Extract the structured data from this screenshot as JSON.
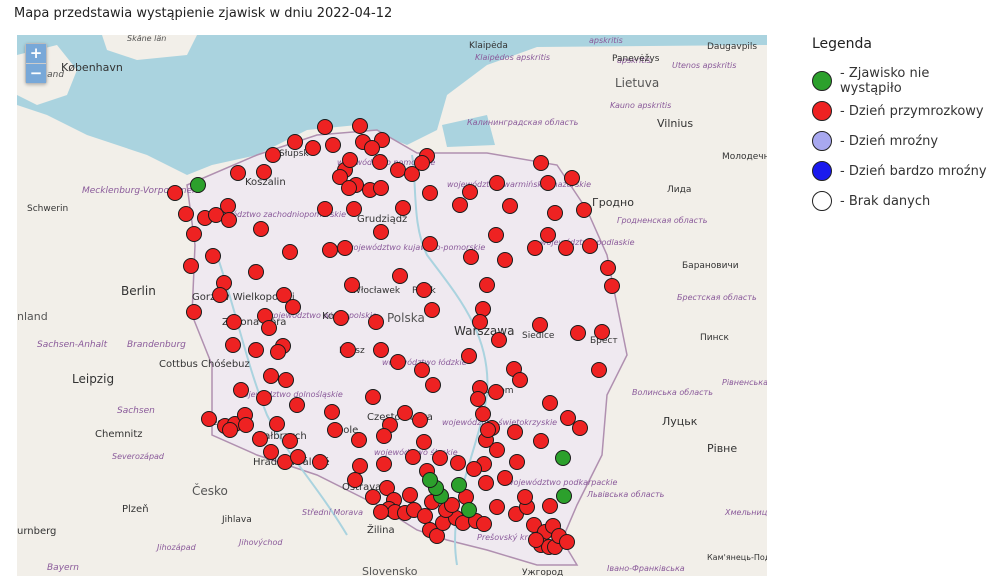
{
  "title": "Mapa przedstawia wystąpienie zjawisk w dniu 2022-04-12",
  "zoom": {
    "in_label": "+",
    "out_label": "−"
  },
  "legend": {
    "heading": "Legenda",
    "items": [
      {
        "label": "- Zjawisko nie wystąpiło",
        "color": "#2ca02c"
      },
      {
        "label": "- Dzień przymrozkowy",
        "color": "#ee2222"
      },
      {
        "label": "- Dzień mroźny",
        "color": "#a8a8f0"
      },
      {
        "label": "- Dzień bardzo mroźny",
        "color": "#1a1aee"
      },
      {
        "label": "- Brak danych",
        "color": "#ffffff"
      }
    ]
  },
  "map_labels": {
    "kobenhavn": "København",
    "sjaelland": "Sjælland",
    "skane": "Skåne län",
    "klaipeda": "Klaipėda",
    "klaipedos": "Klaipėdos apskritis",
    "apskritis1": "apskritis",
    "apskritis2": "apskritis",
    "panevezys": "Panevėžys",
    "utenos": "Utenos apskritis",
    "daugavpils": "Daugavpils",
    "lietuva": "Lietuva",
    "kauno": "Kauno apskritis",
    "vilnius": "Vilnius",
    "kaliningrad": "Калининградская область",
    "molodechno": "Молодечно",
    "mecklenburg": "Mecklenburg-Vorpommern",
    "schwerin": "Schwerin",
    "koszalin": "Koszalin",
    "slupsk": "Słupsk",
    "pomorskie": "województwo pomorskie",
    "warminsko": "województwo warmińsko-mazurskie",
    "lida": "Лида",
    "grodno": "Гродно",
    "grodnenskaya": "Гродненская область",
    "grudziadz": "Grudziądz",
    "zachodnio": "województwo zachodniopomorskie",
    "kujawsko": "województwo kujawsko-pomorskie",
    "podlaskie": "województwo podlaskie",
    "baranovichi": "Барановичи",
    "berlin": "Berlin",
    "gorzow": "Gorzów Wielkopolski",
    "wloclawek": "Włocławek",
    "plock": "Płock",
    "brestobl": "Брестская область",
    "land": "nland",
    "wielkopolskie": "województwo wielkopolskie",
    "konin": "Konin",
    "polska": "Polska",
    "warszawa": "Warszawa",
    "siedlce": "Siedlce",
    "brest": "Брест",
    "pinsk": "Пинск",
    "zielona": "Zielona Góra",
    "sachsen_anhalt": "Sachsen-Anhalt",
    "brandenburg": "Brandenburg",
    "kalisz": "Kalisz",
    "lodzkie": "województwo łódzkie",
    "leipzig": "Leipzig",
    "cottbus": "Cottbus Chóśebuz",
    "radom": "Radom",
    "volynska": "Волинська область",
    "rivnenska": "Рівненська область",
    "sachsen": "Sachsen",
    "dolnoslaskie": "województwo dolnośląskie",
    "legnica": "Legnica",
    "czestochowa": "Częstochowa",
    "chemnitz": "Chemnitz",
    "walbrzych": "Wałbrzych",
    "opole": "Opole",
    "swietokrzyskie": "województwo świętokrzyskie",
    "lutsk": "Луцьк",
    "rivne": "Рівне",
    "severozapad": "Severozápad",
    "hradec": "Hradec Králové",
    "slaskie": "województwo śląskie",
    "cesko": "Česko",
    "ostrava": "Ostrava",
    "podkarpackie": "województwo podkarpackie",
    "lvivska": "Львівська область",
    "plzen": "Plzeň",
    "jihlava": "Jihlava",
    "stredni": "Střední Morava",
    "khmelnytska": "Хмельницька область",
    "urnberg": "urnberg",
    "jihozapad": "Jihozápad",
    "jihovychod": "Jihovýchod",
    "zilina": "Žilina",
    "presovsky": "Prešovský kraj",
    "kamianets": "Кам'янець-Подільський",
    "bayern": "Bayern",
    "slovensko": "Slovensko",
    "uzhgorod": "Ужгород",
    "ivano": "Івано-Франківська"
  },
  "stations": {
    "green": [
      [
        198,
        185
      ],
      [
        563,
        458
      ],
      [
        564,
        496
      ],
      [
        459,
        485
      ],
      [
        469,
        510
      ],
      [
        441,
        496
      ],
      [
        436,
        488
      ],
      [
        430,
        480
      ]
    ],
    "red": [
      [
        175,
        193
      ],
      [
        186,
        214
      ],
      [
        194,
        234
      ],
      [
        191,
        266
      ],
      [
        205,
        218
      ],
      [
        228,
        206
      ],
      [
        216,
        215
      ],
      [
        229,
        220
      ],
      [
        261,
        229
      ],
      [
        238,
        173
      ],
      [
        264,
        172
      ],
      [
        273,
        155
      ],
      [
        295,
        142
      ],
      [
        325,
        127
      ],
      [
        313,
        148
      ],
      [
        333,
        145
      ],
      [
        360,
        126
      ],
      [
        363,
        142
      ],
      [
        345,
        170
      ],
      [
        382,
        140
      ],
      [
        380,
        162
      ],
      [
        372,
        148
      ],
      [
        350,
        160
      ],
      [
        340,
        177
      ],
      [
        356,
        185
      ],
      [
        370,
        190
      ],
      [
        381,
        188
      ],
      [
        398,
        170
      ],
      [
        412,
        174
      ],
      [
        427,
        156
      ],
      [
        422,
        163
      ],
      [
        430,
        193
      ],
      [
        403,
        208
      ],
      [
        354,
        209
      ],
      [
        325,
        209
      ],
      [
        381,
        232
      ],
      [
        345,
        248
      ],
      [
        330,
        250
      ],
      [
        290,
        252
      ],
      [
        213,
        256
      ],
      [
        256,
        272
      ],
      [
        224,
        283
      ],
      [
        220,
        295
      ],
      [
        284,
        295
      ],
      [
        293,
        307
      ],
      [
        265,
        316
      ],
      [
        269,
        328
      ],
      [
        283,
        346
      ],
      [
        194,
        312
      ],
      [
        234,
        322
      ],
      [
        233,
        345
      ],
      [
        256,
        350
      ],
      [
        278,
        352
      ],
      [
        352,
        285
      ],
      [
        400,
        276
      ],
      [
        424,
        290
      ],
      [
        470,
        192
      ],
      [
        460,
        205
      ],
      [
        497,
        183
      ],
      [
        510,
        206
      ],
      [
        496,
        235
      ],
      [
        430,
        244
      ],
      [
        471,
        257
      ],
      [
        487,
        285
      ],
      [
        483,
        309
      ],
      [
        480,
        322
      ],
      [
        505,
        260
      ],
      [
        541,
        163
      ],
      [
        548,
        183
      ],
      [
        572,
        178
      ],
      [
        555,
        213
      ],
      [
        584,
        210
      ],
      [
        590,
        246
      ],
      [
        566,
        248
      ],
      [
        535,
        248
      ],
      [
        548,
        235
      ],
      [
        608,
        268
      ],
      [
        612,
        286
      ],
      [
        341,
        318
      ],
      [
        376,
        322
      ],
      [
        348,
        350
      ],
      [
        381,
        350
      ],
      [
        432,
        310
      ],
      [
        398,
        362
      ],
      [
        422,
        370
      ],
      [
        433,
        385
      ],
      [
        469,
        356
      ],
      [
        499,
        340
      ],
      [
        514,
        369
      ],
      [
        520,
        380
      ],
      [
        480,
        388
      ],
      [
        478,
        399
      ],
      [
        483,
        414
      ],
      [
        515,
        432
      ],
      [
        541,
        441
      ],
      [
        550,
        403
      ],
      [
        568,
        418
      ],
      [
        580,
        428
      ],
      [
        599,
        370
      ],
      [
        602,
        332
      ],
      [
        578,
        333
      ],
      [
        540,
        325
      ],
      [
        241,
        390
      ],
      [
        264,
        398
      ],
      [
        271,
        376
      ],
      [
        286,
        380
      ],
      [
        297,
        405
      ],
      [
        209,
        419
      ],
      [
        225,
        426
      ],
      [
        235,
        424
      ],
      [
        245,
        415
      ],
      [
        230,
        430
      ],
      [
        246,
        425
      ],
      [
        260,
        439
      ],
      [
        277,
        424
      ],
      [
        290,
        441
      ],
      [
        271,
        452
      ],
      [
        285,
        462
      ],
      [
        298,
        457
      ],
      [
        320,
        462
      ],
      [
        332,
        412
      ],
      [
        335,
        430
      ],
      [
        359,
        440
      ],
      [
        373,
        397
      ],
      [
        390,
        425
      ],
      [
        384,
        436
      ],
      [
        405,
        413
      ],
      [
        420,
        420
      ],
      [
        424,
        442
      ],
      [
        413,
        457
      ],
      [
        384,
        464
      ],
      [
        360,
        466
      ],
      [
        355,
        480
      ],
      [
        387,
        488
      ],
      [
        373,
        497
      ],
      [
        394,
        500
      ],
      [
        410,
        495
      ],
      [
        389,
        509
      ],
      [
        395,
        512
      ],
      [
        381,
        512
      ],
      [
        405,
        513
      ],
      [
        414,
        510
      ],
      [
        425,
        516
      ],
      [
        430,
        530
      ],
      [
        437,
        536
      ],
      [
        443,
        523
      ],
      [
        456,
        518
      ],
      [
        463,
        523
      ],
      [
        476,
        521
      ],
      [
        484,
        524
      ],
      [
        497,
        507
      ],
      [
        516,
        514
      ],
      [
        527,
        507
      ],
      [
        534,
        525
      ],
      [
        545,
        532
      ],
      [
        553,
        526
      ],
      [
        541,
        545
      ],
      [
        549,
        547
      ],
      [
        555,
        547
      ],
      [
        559,
        536
      ],
      [
        567,
        542
      ],
      [
        536,
        540
      ],
      [
        550,
        506
      ],
      [
        525,
        497
      ],
      [
        505,
        478
      ],
      [
        486,
        483
      ],
      [
        484,
        464
      ],
      [
        474,
        469
      ],
      [
        458,
        463
      ],
      [
        440,
        458
      ],
      [
        427,
        471
      ],
      [
        432,
        502
      ],
      [
        446,
        510
      ],
      [
        452,
        505
      ],
      [
        466,
        497
      ],
      [
        497,
        450
      ],
      [
        517,
        462
      ],
      [
        486,
        440
      ],
      [
        492,
        428
      ],
      [
        496,
        392
      ],
      [
        488,
        430
      ],
      [
        349,
        188
      ]
    ]
  }
}
